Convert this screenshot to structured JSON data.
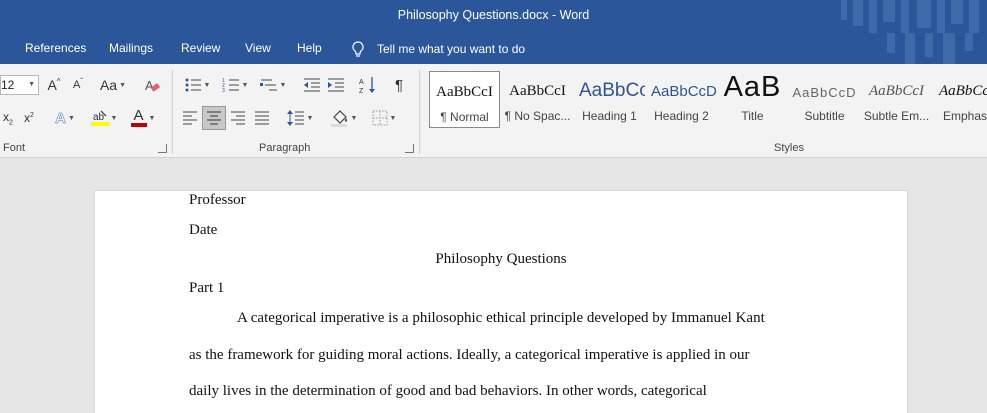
{
  "window": {
    "title": "Philosophy Questions.docx  -  Word"
  },
  "menu": {
    "tabs": [
      "References",
      "Mailings",
      "Review",
      "View",
      "Help"
    ],
    "tell_me": "Tell me what you want to do"
  },
  "ribbon": {
    "font": {
      "size": "12",
      "grow_label": "A",
      "shrink_label": "A",
      "case_label": "Aa",
      "color_label": "A",
      "effects_label": "A",
      "group_label": "Font"
    },
    "paragraph": {
      "group_label": "Paragraph"
    },
    "styles": {
      "group_label": "Styles",
      "items": [
        {
          "preview": "AaBbCcI",
          "name": "¶ Normal",
          "selected": true
        },
        {
          "preview": "AaBbCcI",
          "name": "¶ No Spac...",
          "selected": false
        },
        {
          "preview": "AaBbCc",
          "name": "Heading 1",
          "selected": false
        },
        {
          "preview": "AaBbCcD",
          "name": "Heading 2",
          "selected": false
        },
        {
          "preview": "AaB",
          "name": "Title",
          "selected": false
        },
        {
          "preview": "AaBbCcD",
          "name": "Subtitle",
          "selected": false
        },
        {
          "preview": "AaBbCcI",
          "name": "Subtle Em...",
          "selected": false
        },
        {
          "preview": "AaBbCcI",
          "name": "Emphas",
          "selected": false
        }
      ]
    }
  },
  "document": {
    "lines": [
      "Professor",
      "Date",
      "Philosophy Questions",
      "Part 1",
      "A categorical imperative is a philosophic ethical principle developed by Immanuel Kant",
      "as the framework for guiding moral actions. Ideally, a categorical imperative is applied in our",
      "daily lives in the determination of good and bad behaviors. In other words, categorical"
    ]
  },
  "colors": {
    "title_bar": "#2b579a",
    "ribbon": "#f3f3f3",
    "document_bg": "#e6e6e6",
    "font_color_bar": "#c00000",
    "highlight_bar": "#ffff00",
    "heading_blue": "#2f5496"
  }
}
